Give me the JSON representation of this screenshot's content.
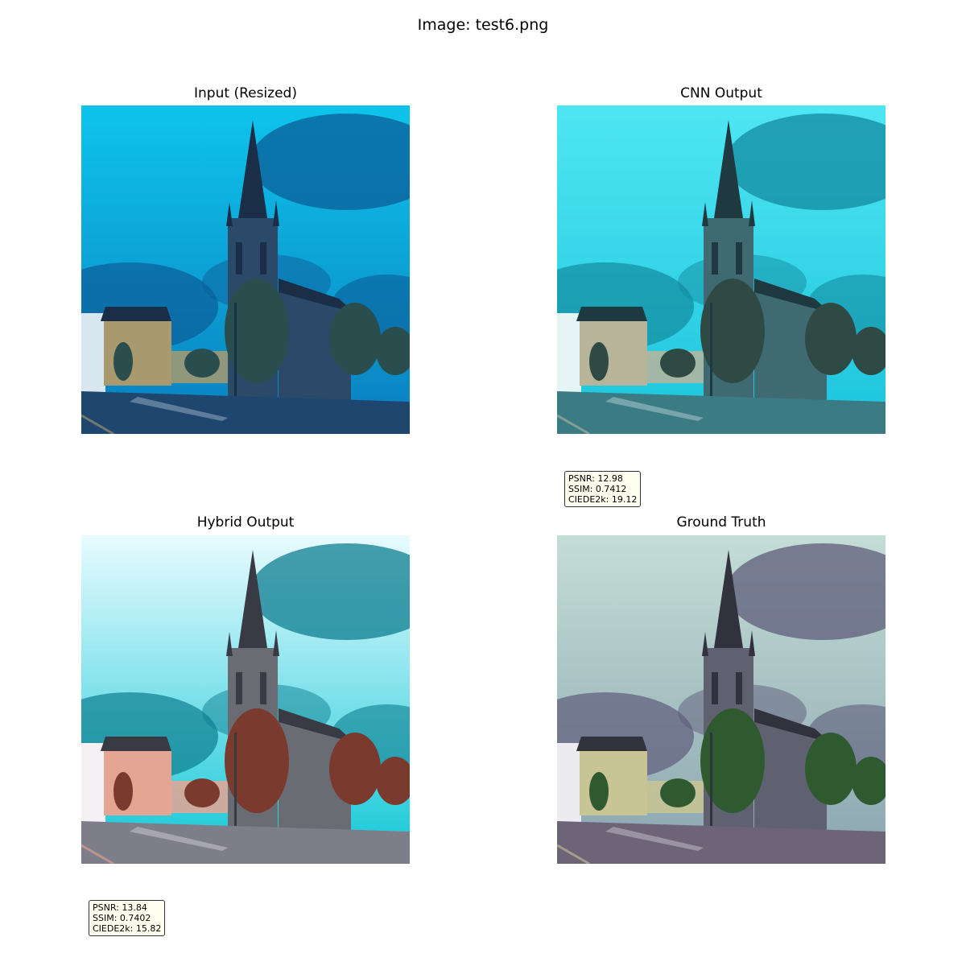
{
  "figure": {
    "title": "Image: test6.png"
  },
  "panels": [
    {
      "title": "Input (Resized)",
      "palette": {
        "sky1": "#0ec4ec",
        "sky2": "#0a7fbf",
        "cloud": "#0b5d97",
        "building": "#2b4a6a",
        "bldDark": "#1a2e48",
        "tree": "#2a4d4e",
        "facade": "#a89a6e",
        "road": "#1e466e",
        "house": "#d8e6f0"
      }
    },
    {
      "title": "CNN Output",
      "palette": {
        "sky1": "#4fe6f3",
        "sky2": "#1cc4dc",
        "cloud": "#138aa0",
        "building": "#3f6a72",
        "bldDark": "#1e3a40",
        "tree": "#2f4a45",
        "facade": "#b8b49a",
        "road": "#3b7b84",
        "house": "#e6f4f6"
      }
    },
    {
      "title": "Hybrid Output",
      "palette": {
        "sky1": "#e8fbff",
        "sky2": "#10c7d6",
        "cloud": "#0d7d90",
        "building": "#6a6c74",
        "bldDark": "#383a44",
        "tree": "#7b3a2e",
        "facade": "#e6a593",
        "road": "#7d7e8a",
        "house": "#f5f0f4"
      }
    },
    {
      "title": "Ground Truth",
      "palette": {
        "sky1": "#c4ddd6",
        "sky2": "#8aa5b0",
        "cloud": "#5e5c7a",
        "building": "#5f6170",
        "bldDark": "#32323e",
        "tree": "#2f5a30",
        "facade": "#c9c493",
        "road": "#6e6478",
        "house": "#ecebf0"
      }
    }
  ],
  "metrics_boxes": [
    {
      "under": "CNN Output",
      "psnr": "PSNR: 12.98",
      "ssim": "SSIM: 0.7412",
      "ciede": "CIEDE2k: 19.12"
    },
    {
      "under": "Hybrid Output",
      "psnr": "PSNR: 13.84",
      "ssim": "SSIM: 0.7402",
      "ciede": "CIEDE2k: 15.82"
    }
  ]
}
